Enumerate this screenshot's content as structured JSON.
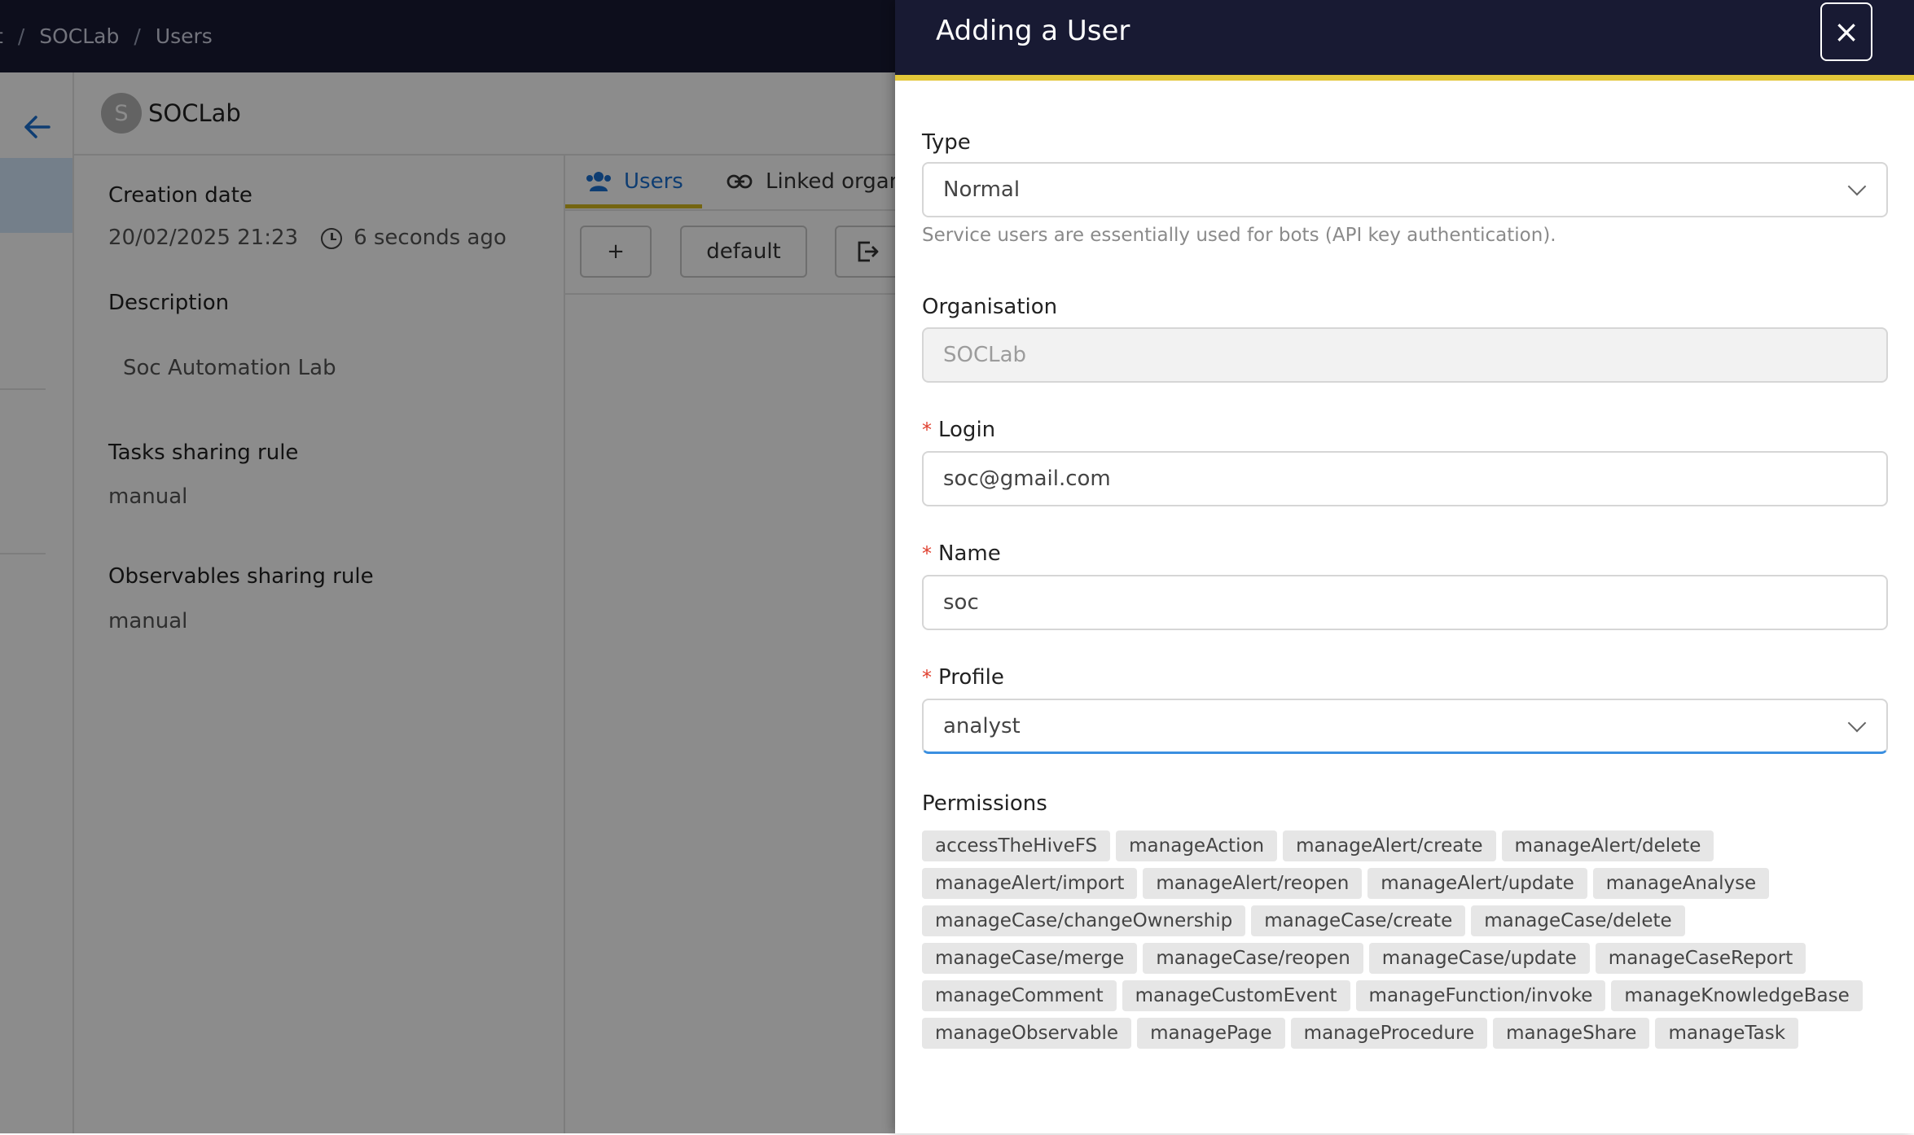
{
  "breadcrumb": {
    "first": "t",
    "org": "SOCLab",
    "page": "Users",
    "separator": "/"
  },
  "org_header": {
    "avatar_letter": "S",
    "name": "SOCLab"
  },
  "details": {
    "creation_label": "Creation date",
    "creation_value": "20/02/2025 21:23",
    "creation_relative": "6 seconds ago",
    "description_label": "Description",
    "description_value": "Soc Automation Lab",
    "tasks_rule_label": "Tasks sharing rule",
    "tasks_rule_value": "manual",
    "observables_rule_label": "Observables sharing rule",
    "observables_rule_value": "manual"
  },
  "tabs": [
    {
      "label": "Users"
    },
    {
      "label": "Linked organisations"
    }
  ],
  "toolbar": {
    "add_label": "+",
    "default_label": "default"
  },
  "drawer": {
    "title": "Adding a User",
    "close_label": "×",
    "type_label": "Type",
    "type_value": "Normal",
    "type_help": "Service users are essentially used for bots (API key authentication).",
    "org_label": "Organisation",
    "org_value": "SOCLab",
    "login_label": "Login",
    "login_value": "soc@gmail.com",
    "name_label": "Name",
    "name_value": "soc",
    "profile_label": "Profile",
    "profile_value": "analyst",
    "permissions_label": "Permissions",
    "required_mark": "*",
    "permissions": [
      "accessTheHiveFS",
      "manageAction",
      "manageAlert/create",
      "manageAlert/delete",
      "manageAlert/import",
      "manageAlert/reopen",
      "manageAlert/update",
      "manageAnalyse",
      "manageCase/changeOwnership",
      "manageCase/create",
      "manageCase/delete",
      "manageCase/merge",
      "manageCase/reopen",
      "manageCase/update",
      "manageCaseReport",
      "manageComment",
      "manageCustomEvent",
      "manageFunction/invoke",
      "manageKnowledgeBase",
      "manageObservable",
      "managePage",
      "manageProcedure",
      "manageShare",
      "manageTask"
    ]
  },
  "colors": {
    "topbar": "#181a33",
    "accent_yellow": "#e3c73a",
    "link_blue": "#1a6fd0",
    "required_red": "#e0402f"
  }
}
